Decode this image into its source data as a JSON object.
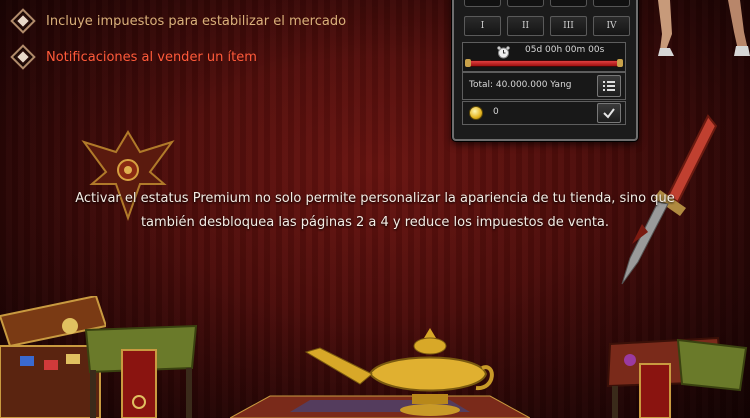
{
  "features": [
    {
      "text": "Incluye impuestos para estabilizar el mercado",
      "color": "#d9b07a"
    },
    {
      "text": "Notificaciones al vender un ítem",
      "color": "#ff5a3a"
    }
  ],
  "shop": {
    "page_buttons": [
      "I",
      "II",
      "III",
      "IV"
    ],
    "timer": "05d 00h 00m 00s",
    "total": "Total: 40.000.000 Yang",
    "coins": "0",
    "icons": {
      "clock": "alarm-clock-icon",
      "list": "list-icon",
      "coin": "coin-icon",
      "confirm": "checkmark-icon"
    }
  },
  "description": "Activar el estatus Premium no solo permite personalizar la apariencia de tu tienda, sino que también desbloquea las páginas 2 a 4 y reduce los impuestos de venta.",
  "colors": {
    "background": "#4a0c0a",
    "accent_gold": "#c9a24a",
    "highlight_red": "#ff5a3a"
  }
}
